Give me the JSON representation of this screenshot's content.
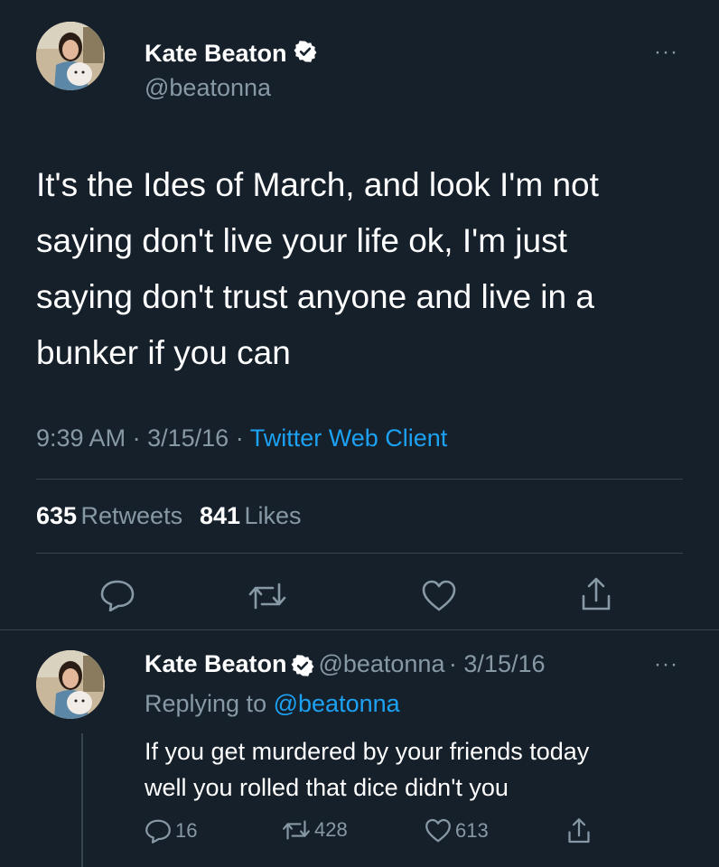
{
  "main_tweet": {
    "author_name": "Kate Beaton",
    "author_handle": "@beatonna",
    "text_lines": [
      "It's the Ides of March, and look I'm not",
      "saying don't live your life ok, I'm just",
      "saying don't trust anyone and live in a",
      "bunker if you can"
    ],
    "time": "9:39 AM",
    "date": "3/15/16",
    "separator": "·",
    "source": "Twitter Web Client",
    "retweets_count": "635",
    "retweets_label": "Retweets",
    "likes_count": "841",
    "likes_label": "Likes",
    "more_label": "···"
  },
  "reply_tweet": {
    "author_name": "Kate Beaton",
    "author_handle": "@beatonna",
    "date": "· 3/15/16",
    "replying_prefix": "Replying to",
    "replying_to": "@beatonna",
    "text_lines": [
      "If you get murdered by your friends today",
      "well you rolled that dice didn't you"
    ],
    "reply_count": "16",
    "retweet_count": "428",
    "like_count": "613",
    "more_label": "···"
  },
  "colors": {
    "background": "#15202b",
    "secondary_text": "#8899a6",
    "link": "#1da1f2",
    "divider": "#38444d"
  },
  "icons": [
    "verified-badge-icon",
    "more-icon",
    "reply-icon",
    "retweet-icon",
    "like-icon",
    "share-icon"
  ]
}
